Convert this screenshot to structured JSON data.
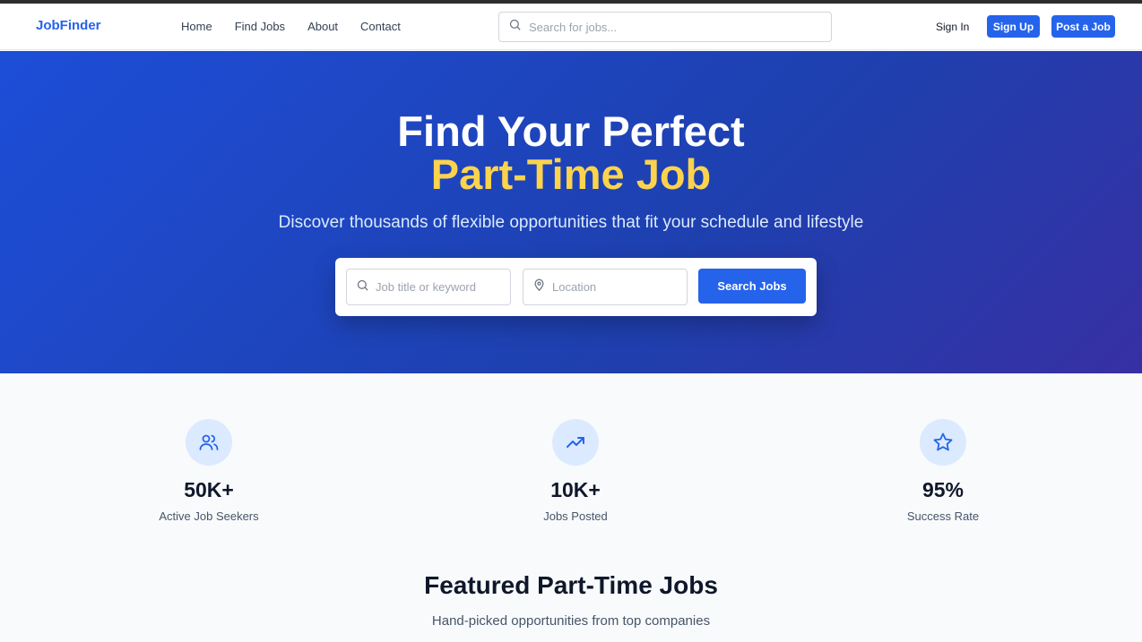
{
  "header": {
    "logo": "JobFinder",
    "nav": [
      "Home",
      "Find Jobs",
      "About",
      "Contact"
    ],
    "search_placeholder": "Search for jobs...",
    "sign_in": "Sign In",
    "sign_up": "Sign Up",
    "post_job": "Post a Job"
  },
  "hero": {
    "title_line1": "Find Your Perfect",
    "title_line2": "Part-Time Job",
    "subtitle": "Discover thousands of flexible opportunities that fit your schedule and lifestyle",
    "keyword_placeholder": "Job title or keyword",
    "location_placeholder": "Location",
    "search_button": "Search Jobs"
  },
  "stats": [
    {
      "icon": "users-icon",
      "value": "50K+",
      "label": "Active Job Seekers"
    },
    {
      "icon": "trending-up-icon",
      "value": "10K+",
      "label": "Jobs Posted"
    },
    {
      "icon": "star-icon",
      "value": "95%",
      "label": "Success Rate"
    }
  ],
  "featured": {
    "title": "Featured Part-Time Jobs",
    "subtitle": "Hand-picked opportunities from top companies"
  },
  "colors": {
    "primary": "#2563eb",
    "accent": "#fcd34d",
    "hero_start": "#1d4ed8",
    "hero_end": "#3730a3"
  }
}
